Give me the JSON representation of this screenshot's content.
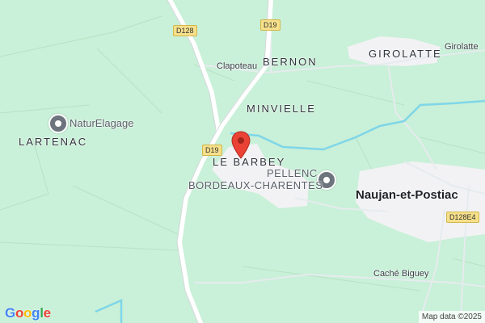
{
  "map": {
    "places": {
      "bernon": "BERNON",
      "girolatte_caps": "GIROLATTE",
      "minvielle": "MINVIELLE",
      "lartenac": "LARTENAC",
      "le_barbey": "LE BARBEY",
      "bordeaux_charentes": "BORDEAUX-CHARENTES",
      "pellenc": "PELLENC",
      "naujan": "Naujan-et-Postiac"
    },
    "streets": {
      "clapoteau": "Clapoteau",
      "girolatte": "Girolatte",
      "cache_biguey": "Caché Biguey"
    },
    "roads": {
      "d128": "D128",
      "d19_top": "D19",
      "d19_mid": "D19",
      "d128e4": "D128E4"
    },
    "pois": {
      "naturelagage": "NaturElagage"
    },
    "logo": {
      "letters": [
        {
          "ch": "G",
          "color": "#4285F4"
        },
        {
          "ch": "o",
          "color": "#EA4335"
        },
        {
          "ch": "o",
          "color": "#FBBC05"
        },
        {
          "ch": "g",
          "color": "#4285F4"
        },
        {
          "ch": "l",
          "color": "#34A853"
        },
        {
          "ch": "e",
          "color": "#EA4335"
        }
      ]
    },
    "attribution": "Map data ©2025",
    "marker_color": "#EA4335",
    "colors": {
      "land": "#c9f0d8",
      "road": "#ffffff",
      "water": "#7fd6e8",
      "builtup": "#f2f2f4"
    }
  }
}
